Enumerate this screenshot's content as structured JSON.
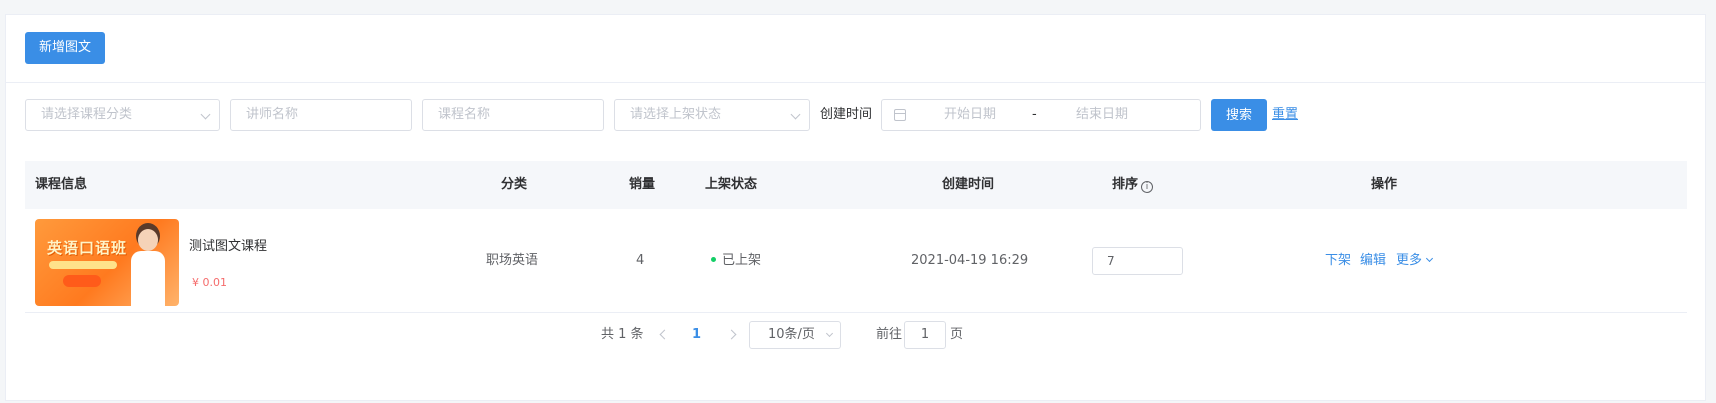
{
  "toolbar": {
    "add_label": "新增图文"
  },
  "filters": {
    "category_placeholder": "请选择课程分类",
    "teacher_placeholder": "讲师名称",
    "course_placeholder": "课程名称",
    "status_placeholder": "请选择上架状态",
    "created_label": "创建时间",
    "start_date_placeholder": "开始日期",
    "range_separator": "-",
    "end_date_placeholder": "结束日期",
    "search_label": "搜索",
    "reset_label": "重置"
  },
  "table": {
    "headers": {
      "info": "课程信息",
      "category": "分类",
      "sales": "销量",
      "status": "上架状态",
      "created": "创建时间",
      "sort": "排序",
      "actions": "操作"
    },
    "rows": [
      {
        "thumb_title": "英语口语班",
        "name": "测试图文课程",
        "price": "¥ 0.01",
        "category": "职场英语",
        "sales": "4",
        "status": "已上架",
        "created": "2021-04-19 16:29",
        "sort": "7",
        "action_off": "下架",
        "action_edit": "编辑",
        "action_more": "更多"
      }
    ]
  },
  "pagination": {
    "total_text": "共 1 条",
    "current_page": "1",
    "page_size": "10条/页",
    "goto_prefix": "前往",
    "goto_value": "1",
    "goto_suffix": "页"
  },
  "colors": {
    "primary": "#3a8ee6",
    "price": "#f56c6c",
    "status_on": "#13ce66"
  }
}
